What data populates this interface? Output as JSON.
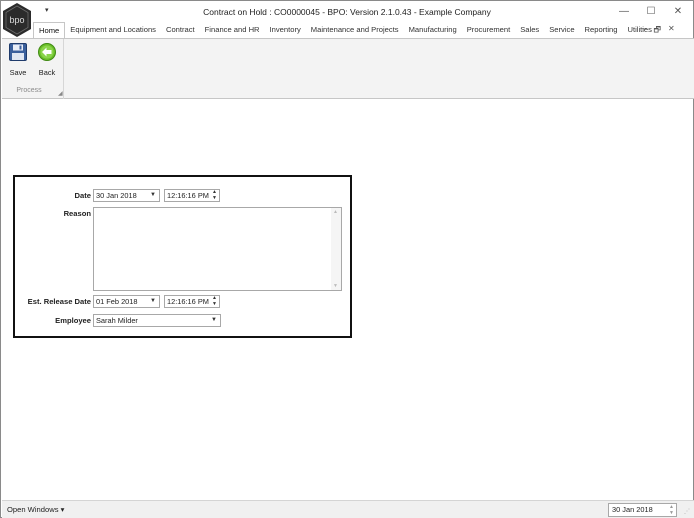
{
  "window": {
    "title": "Contract on Hold : CO0000045 - BPO: Version 2.1.0.43 - Example Company",
    "logo_text": "bpo",
    "qat_arrow": "▾",
    "min_glyph": "—",
    "max_glyph": "☐",
    "close_glyph": "✕"
  },
  "ribbon": {
    "tabs": [
      {
        "label": "Home",
        "active": true
      },
      {
        "label": "Equipment and Locations"
      },
      {
        "label": "Contract"
      },
      {
        "label": "Finance and HR"
      },
      {
        "label": "Inventory"
      },
      {
        "label": "Maintenance and Projects"
      },
      {
        "label": "Manufacturing"
      },
      {
        "label": "Procurement"
      },
      {
        "label": "Sales"
      },
      {
        "label": "Service"
      },
      {
        "label": "Reporting"
      },
      {
        "label": "Utilities"
      }
    ],
    "mdi_min": "–",
    "mdi_restore": "🗗",
    "mdi_close": "✕",
    "group": {
      "label": "Process",
      "save_label": "Save",
      "back_label": "Back"
    }
  },
  "form": {
    "date_label": "Date",
    "date_value": "30 Jan 2018",
    "date_time": "12:16:16 PM",
    "reason_label": "Reason",
    "reason_value": "",
    "release_label": "Est. Release Date",
    "release_value": "01 Feb 2018",
    "release_time": "12:16:16 PM",
    "employee_label": "Employee",
    "employee_value": "Sarah Milder"
  },
  "status": {
    "open_windows": "Open Windows",
    "date": "30 Jan 2018"
  },
  "colors": {
    "logo": "#2b2b2b",
    "save_icon": "#3a5f9c",
    "back_icon": "#6bbf2a"
  }
}
